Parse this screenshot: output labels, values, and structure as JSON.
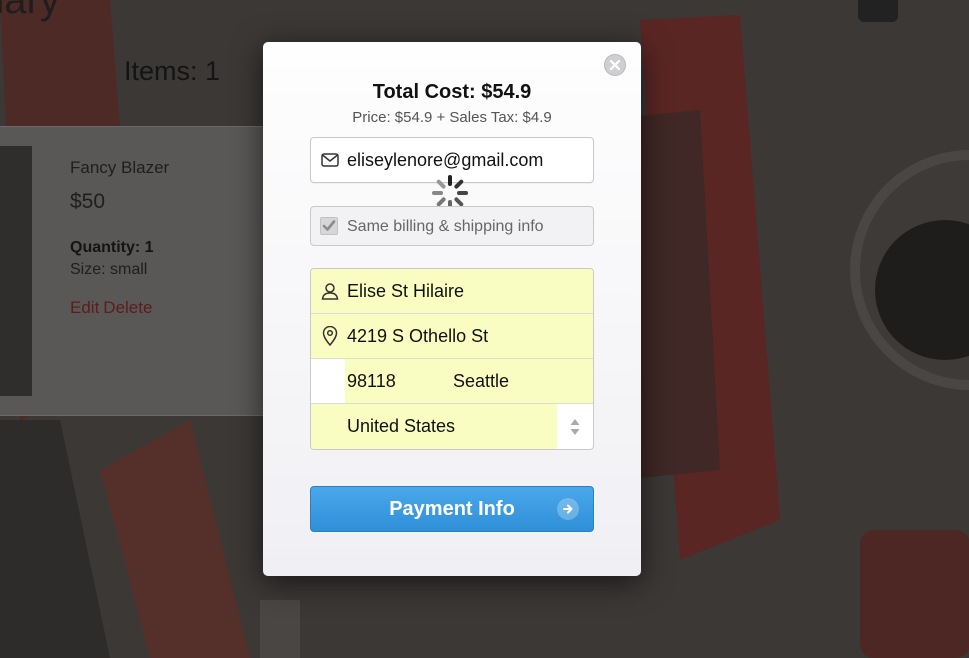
{
  "background": {
    "page_title_fragment": "nary",
    "items_label": "Items: 1",
    "product": {
      "name": "Fancy Blazer",
      "price": "$50",
      "quantity": "Quantity: 1",
      "size": "Size: small",
      "edit_label": "Edit",
      "delete_label": "Delete"
    }
  },
  "modal": {
    "total": "Total Cost: $54.9",
    "breakdown": "Price: $54.9 + Sales Tax: $4.9",
    "email": {
      "icon": "envelope-icon",
      "value": "eliseylenore@gmail.com"
    },
    "same_info": {
      "label": "Same billing & shipping info",
      "checked": true
    },
    "address": {
      "name": "Elise St Hilaire",
      "street": "4219 S Othello St",
      "zip": "98118",
      "city": "Seattle",
      "country": "United States"
    },
    "submit_label": "Payment Info"
  },
  "colors": {
    "button": "#3a9be1",
    "autofill": "#fafdc2"
  }
}
